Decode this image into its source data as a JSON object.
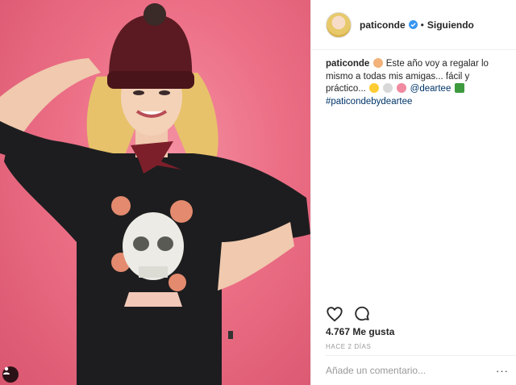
{
  "header": {
    "username": "paticonde",
    "separator": "•",
    "follow_label": "Siguiendo"
  },
  "caption": {
    "username": "paticonde",
    "text_1": "Este año voy a regalar lo mismo a todas mis amigas... fácil y práctico...",
    "mention": "@deartee",
    "hashtag": "#paticondebydeartee"
  },
  "stats": {
    "likes": "4.767 Me gusta",
    "time_ago": "HACE 2 DÍAS"
  },
  "comment": {
    "placeholder": "Añade un comentario...",
    "more_label": "···"
  },
  "icons": {
    "verified": "verified-badge-icon",
    "like": "heart-icon",
    "comment": "comment-icon",
    "tagged": "user-tag-icon",
    "more": "more-options-icon"
  },
  "colors": {
    "photo_background": "#ec6f86",
    "link": "#003569",
    "verified": "#3897f0",
    "muted": "#999999"
  }
}
